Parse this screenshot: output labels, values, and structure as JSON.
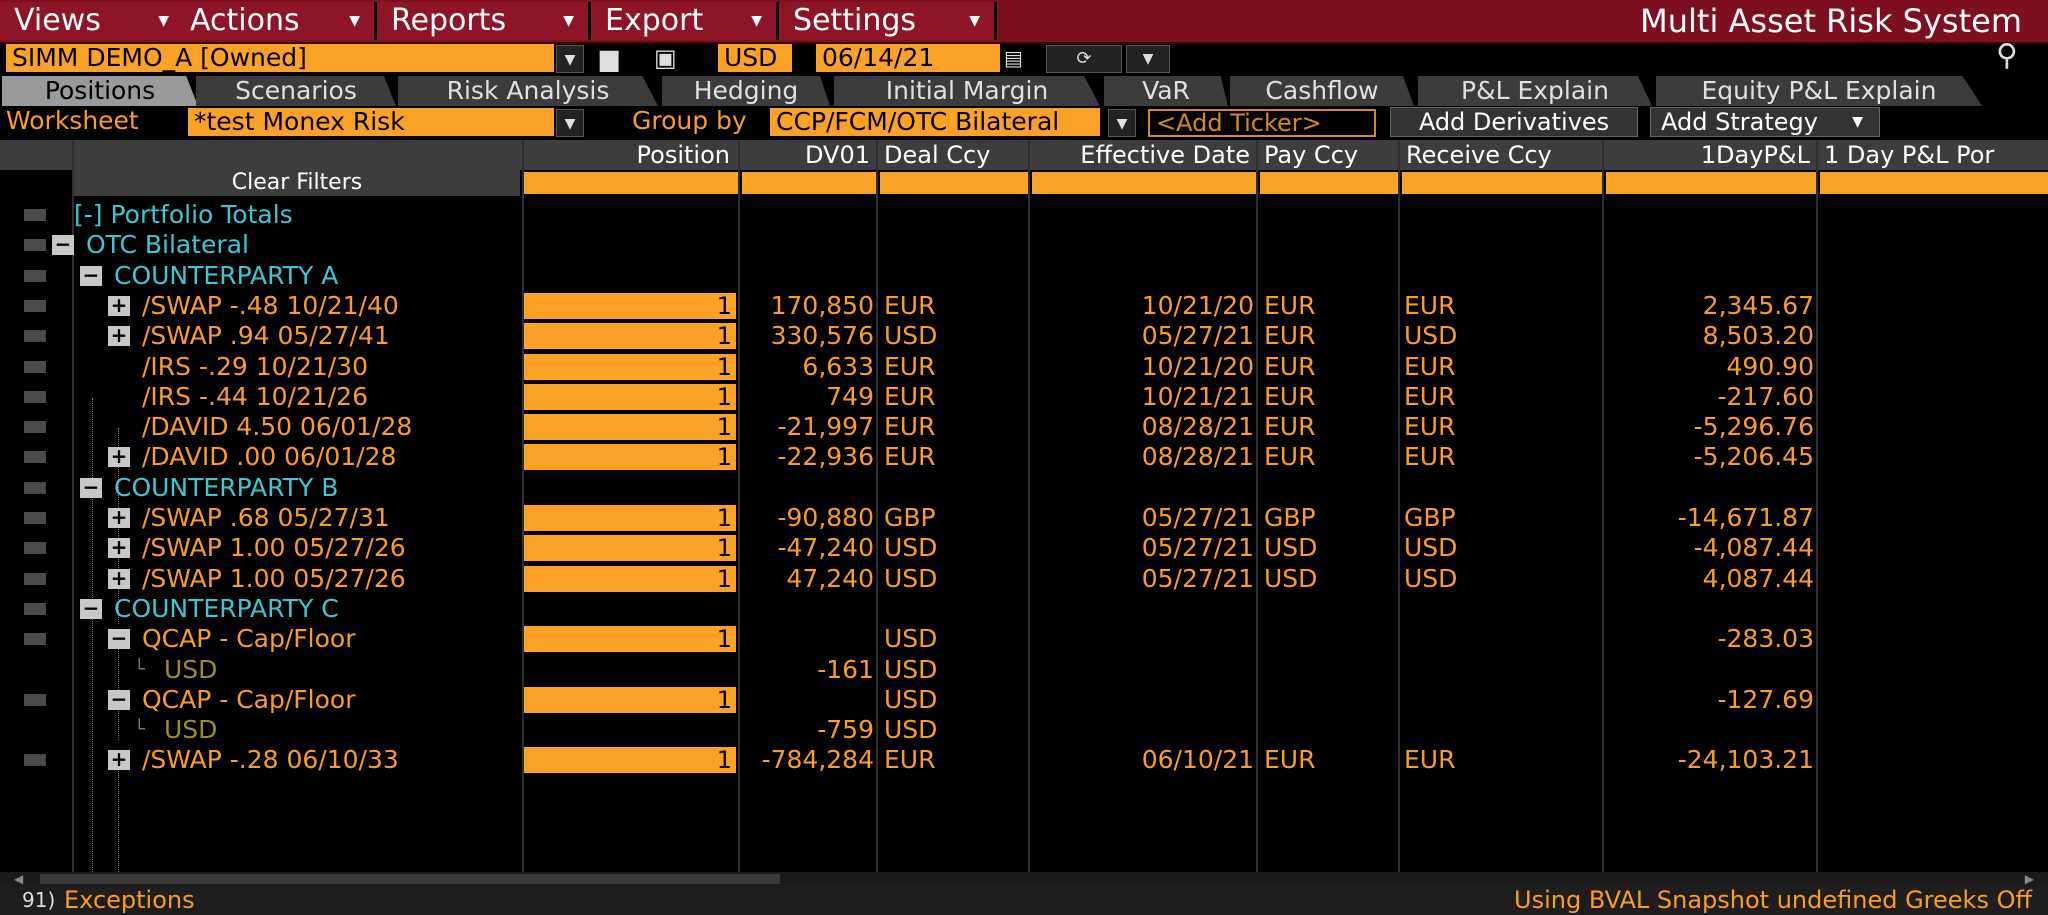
{
  "menubar": {
    "items": [
      "Views",
      "Actions",
      "Reports",
      "Export",
      "Settings"
    ],
    "app_title": "Multi Asset Risk System"
  },
  "toolbar": {
    "portfolio": "SIMM DEMO_A [Owned]",
    "currency": "USD",
    "date": "06/14/21"
  },
  "tabs": [
    "Positions",
    "Scenarios",
    "Risk Analysis",
    "Hedging",
    "Initial Margin",
    "VaR",
    "Cashflow",
    "P&L Explain",
    "Equity P&L Explain"
  ],
  "worksheet": {
    "label": "Worksheet",
    "value": "*test Monex Risk",
    "group_label": "Group by",
    "group_value": "CCP/FCM/OTC Bilateral",
    "ticker_placeholder": "<Add Ticker>",
    "add_derivatives": "Add Derivatives",
    "add_strategy": "Add Strategy"
  },
  "grid": {
    "clear_filters": "Clear Filters",
    "columns": [
      "Position",
      "DV01",
      "Deal Ccy",
      "Effective Date",
      "Pay Ccy",
      "Receive Ccy",
      "1DayP&L",
      "1 Day P&L Por"
    ],
    "rows": [
      {
        "toggle": "",
        "name": "[-] Portfolio Totals",
        "pos": "",
        "dv01": "",
        "deal": "",
        "eff": "",
        "pay": "",
        "recv": "",
        "pnl": ""
      },
      {
        "toggle": "−",
        "name": "OTC Bilateral",
        "pos": "",
        "dv01": "",
        "deal": "",
        "eff": "",
        "pay": "",
        "recv": "",
        "pnl": ""
      },
      {
        "toggle": "−",
        "name": "COUNTERPARTY A",
        "pos": "",
        "dv01": "",
        "deal": "",
        "eff": "",
        "pay": "",
        "recv": "",
        "pnl": ""
      },
      {
        "toggle": "+",
        "name": "/SWAP -.48 10/21/40",
        "pos": "1",
        "dv01": "170,850",
        "deal": "EUR",
        "eff": "10/21/20",
        "pay": "EUR",
        "recv": "EUR",
        "pnl": "2,345.67"
      },
      {
        "toggle": "+",
        "name": "/SWAP .94 05/27/41",
        "pos": "1",
        "dv01": "330,576",
        "deal": "USD",
        "eff": "05/27/21",
        "pay": "EUR",
        "recv": "USD",
        "pnl": "8,503.20"
      },
      {
        "toggle": "",
        "name": "/IRS -.29 10/21/30",
        "pos": "1",
        "dv01": "6,633",
        "deal": "EUR",
        "eff": "10/21/20",
        "pay": "EUR",
        "recv": "EUR",
        "pnl": "490.90"
      },
      {
        "toggle": "",
        "name": "/IRS -.44 10/21/26",
        "pos": "1",
        "dv01": "749",
        "deal": "EUR",
        "eff": "10/21/21",
        "pay": "EUR",
        "recv": "EUR",
        "pnl": "-217.60"
      },
      {
        "toggle": "",
        "name": "/DAVID 4.50 06/01/28",
        "pos": "1",
        "dv01": "-21,997",
        "deal": "EUR",
        "eff": "08/28/21",
        "pay": "EUR",
        "recv": "EUR",
        "pnl": "-5,296.76"
      },
      {
        "toggle": "+",
        "name": "/DAVID .00 06/01/28",
        "pos": "1",
        "dv01": "-22,936",
        "deal": "EUR",
        "eff": "08/28/21",
        "pay": "EUR",
        "recv": "EUR",
        "pnl": "-5,206.45"
      },
      {
        "toggle": "−",
        "name": "COUNTERPARTY B",
        "pos": "",
        "dv01": "",
        "deal": "",
        "eff": "",
        "pay": "",
        "recv": "",
        "pnl": ""
      },
      {
        "toggle": "+",
        "name": "/SWAP .68 05/27/31",
        "pos": "1",
        "dv01": "-90,880",
        "deal": "GBP",
        "eff": "05/27/21",
        "pay": "GBP",
        "recv": "GBP",
        "pnl": "-14,671.87"
      },
      {
        "toggle": "+",
        "name": "/SWAP 1.00 05/27/26",
        "pos": "1",
        "dv01": "-47,240",
        "deal": "USD",
        "eff": "05/27/21",
        "pay": "USD",
        "recv": "USD",
        "pnl": "-4,087.44"
      },
      {
        "toggle": "+",
        "name": "/SWAP 1.00 05/27/26",
        "pos": "1",
        "dv01": "47,240",
        "deal": "USD",
        "eff": "05/27/21",
        "pay": "USD",
        "recv": "USD",
        "pnl": "4,087.44"
      },
      {
        "toggle": "−",
        "name": "COUNTERPARTY C",
        "pos": "",
        "dv01": "",
        "deal": "",
        "eff": "",
        "pay": "",
        "recv": "",
        "pnl": ""
      },
      {
        "toggle": "−",
        "name": "QCAP - Cap/Floor",
        "pos": "1",
        "dv01": "",
        "deal": "USD",
        "eff": "",
        "pay": "",
        "recv": "",
        "pnl": "-283.03"
      },
      {
        "toggle": "",
        "name": "USD",
        "pos": "",
        "dv01": "-161",
        "deal": "USD",
        "eff": "",
        "pay": "",
        "recv": "",
        "pnl": ""
      },
      {
        "toggle": "−",
        "name": "QCAP - Cap/Floor",
        "pos": "1",
        "dv01": "",
        "deal": "USD",
        "eff": "",
        "pay": "",
        "recv": "",
        "pnl": "-127.69"
      },
      {
        "toggle": "",
        "name": "USD",
        "pos": "",
        "dv01": "-759",
        "deal": "USD",
        "eff": "",
        "pay": "",
        "recv": "",
        "pnl": ""
      },
      {
        "toggle": "+",
        "name": "/SWAP -.28 06/10/33",
        "pos": "1",
        "dv01": "-784,284",
        "deal": "EUR",
        "eff": "06/10/21",
        "pay": "EUR",
        "recv": "EUR",
        "pnl": "-24,103.21"
      }
    ]
  },
  "statusbar": {
    "left_num": "91)",
    "left_label": "Exceptions",
    "right": "Using BVAL Snapshot undefined  Greeks Off"
  }
}
